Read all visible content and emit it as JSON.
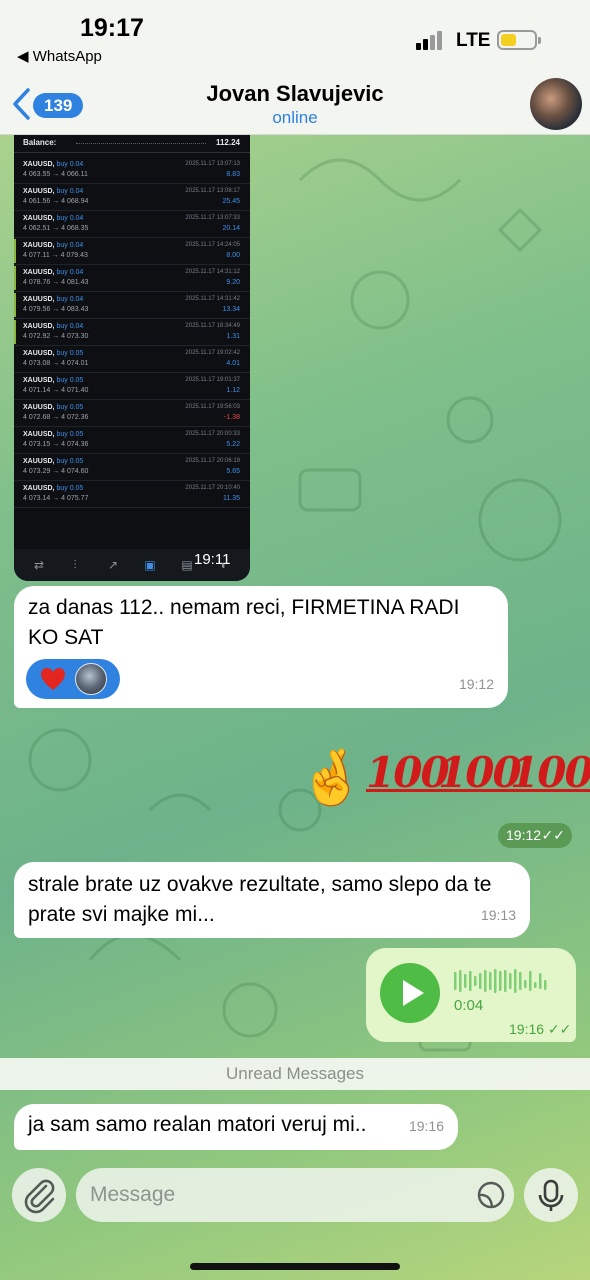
{
  "status_bar": {
    "time": "19:17",
    "back_app": "◀ WhatsApp",
    "network": "LTE"
  },
  "header": {
    "unread_count": "139",
    "contact_name": "Jovan Slavujevic",
    "contact_status": "online"
  },
  "screenshot": {
    "balance_label": "Balance:",
    "balance_value": "112.24",
    "trades": [
      {
        "symbol": "XAUUSD,",
        "side": "buy 0.04",
        "prices": "4 063.55 → 4 066.11",
        "time": "2025.11.17 13:07:13",
        "profit": "8.83"
      },
      {
        "symbol": "XAUUSD,",
        "side": "buy 0.04",
        "prices": "4 061.56 → 4 068.94",
        "time": "2025.11.17 13:08:17",
        "profit": "25.45"
      },
      {
        "symbol": "XAUUSD,",
        "side": "buy 0.04",
        "prices": "4 062.51 → 4 068.35",
        "time": "2025.11.17 13:07:33",
        "profit": "20.14"
      },
      {
        "symbol": "XAUUSD,",
        "side": "buy 0.04",
        "prices": "4 077.11 → 4 079.43",
        "time": "2025.11.17 14:24:05",
        "profit": "8.00"
      },
      {
        "symbol": "XAUUSD,",
        "side": "buy 0.04",
        "prices": "4 078.76 → 4 081.43",
        "time": "2025.11.17 14:31:12",
        "profit": "9.20"
      },
      {
        "symbol": "XAUUSD,",
        "side": "buy 0.04",
        "prices": "4 079.56 → 4 083.43",
        "time": "2025.11.17 14:31:42",
        "profit": "13.34"
      },
      {
        "symbol": "XAUUSD,",
        "side": "buy 0.04",
        "prices": "4 072.92 → 4 073.30",
        "time": "2025.11.17 18:34:49",
        "profit": "1.31"
      },
      {
        "symbol": "XAUUSD,",
        "side": "buy 0.05",
        "prices": "4 073.08 → 4 074.01",
        "time": "2025.11.17 19:02:42",
        "profit": "4.01"
      },
      {
        "symbol": "XAUUSD,",
        "side": "buy 0.05",
        "prices": "4 071.14 → 4 071.40",
        "time": "2025.11.17 19:01:37",
        "profit": "1.12"
      },
      {
        "symbol": "XAUUSD,",
        "side": "buy 0.05",
        "prices": "4 072.68 → 4 072.36",
        "time": "2025.11.17 19:56:03",
        "profit": "-1.38"
      },
      {
        "symbol": "XAUUSD,",
        "side": "buy 0.05",
        "prices": "4 073.15 → 4 074.36",
        "time": "2025.11.17 20:00:33",
        "profit": "5.22"
      },
      {
        "symbol": "XAUUSD,",
        "side": "buy 0.05",
        "prices": "4 073.29 → 4 074.60",
        "time": "2025.11.17 20:06:19",
        "profit": "5.65"
      },
      {
        "symbol": "XAUUSD,",
        "side": "buy 0.05",
        "prices": "4 073.14 → 4 075.77",
        "time": "2025.11.17 20:10:40",
        "profit": "11.35"
      }
    ],
    "sent_time": "19:11"
  },
  "messages": {
    "msg1": {
      "text": "za danas 112.. nemam reci, FIRMETINA RADI KO SAT",
      "time": "19:12"
    },
    "emoji": {
      "fingers": "🤞",
      "hundreds": [
        "100",
        "100",
        "100"
      ],
      "time": "19:12"
    },
    "msg2": {
      "text": "strale brate uz ovakve rezultate, samo slepo da te prate svi majke mi...",
      "time": "19:13"
    },
    "voice": {
      "duration": "0:04",
      "time": "19:16"
    },
    "unread_divider": "Unread Messages",
    "msg3": {
      "text": "ja sam samo realan matori veruj mi..",
      "time": "19:16"
    }
  },
  "input": {
    "placeholder": "Message"
  },
  "colors": {
    "accent": "#2f82e0",
    "voice_green": "#4fbc45",
    "outgoing_bubble": "#e2f6c9",
    "loss_red": "#e24a4a"
  },
  "icons": [
    "back-chevron-icon",
    "signal-icon",
    "battery-icon",
    "heart-icon",
    "play-icon",
    "waveform-icon",
    "double-check-icon",
    "paperclip-icon",
    "sticker-icon",
    "microphone-icon"
  ]
}
